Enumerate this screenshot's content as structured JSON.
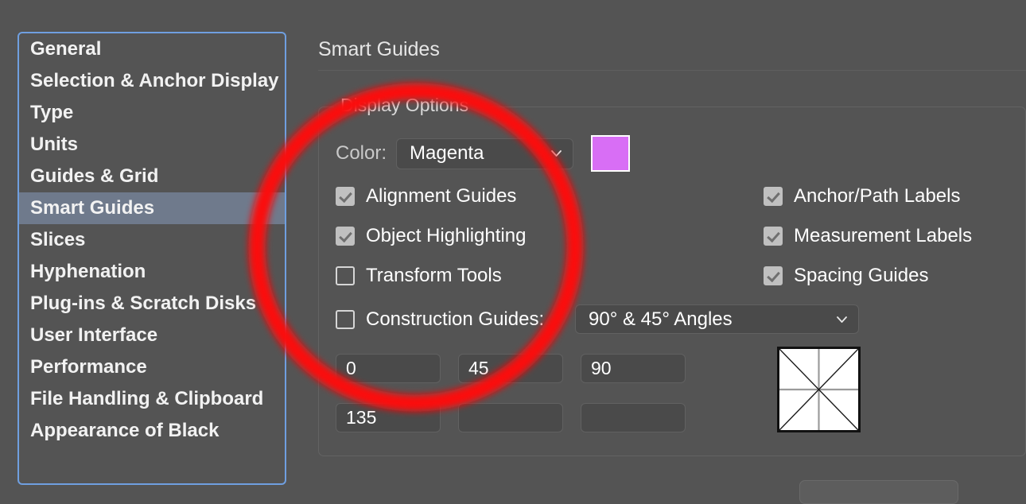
{
  "sidebar": {
    "selected": "Smart Guides",
    "items": [
      {
        "label": "General"
      },
      {
        "label": "Selection & Anchor Display"
      },
      {
        "label": "Type"
      },
      {
        "label": "Units"
      },
      {
        "label": "Guides & Grid"
      },
      {
        "label": "Smart Guides"
      },
      {
        "label": "Slices"
      },
      {
        "label": "Hyphenation"
      },
      {
        "label": "Plug-ins & Scratch Disks"
      },
      {
        "label": "User Interface"
      },
      {
        "label": "Performance"
      },
      {
        "label": "File Handling & Clipboard"
      },
      {
        "label": "Appearance of Black"
      }
    ]
  },
  "panel": {
    "title": "Smart Guides",
    "group_title": "Display Options",
    "color": {
      "label": "Color:",
      "value": "Magenta",
      "swatch_hex": "#d86ef5",
      "chevron_icon": "chevron-down-icon"
    },
    "checkboxes_left": [
      {
        "label": "Alignment Guides",
        "checked": true
      },
      {
        "label": "Object Highlighting",
        "checked": true
      },
      {
        "label": "Transform Tools",
        "checked": false
      }
    ],
    "checkboxes_right": [
      {
        "label": "Anchor/Path Labels",
        "checked": true
      },
      {
        "label": "Measurement Labels",
        "checked": true
      },
      {
        "label": "Spacing Guides",
        "checked": true
      }
    ],
    "construction": {
      "label": "Construction Guides:",
      "checked": false,
      "value": "90° & 45° Angles",
      "chevron_icon": "chevron-down-icon"
    },
    "angles": [
      "0",
      "45",
      "90",
      "135",
      "",
      ""
    ],
    "angle_preview_icon": "angle-preview-grid"
  },
  "annotation": {
    "color_hex": "#fb0c0c",
    "shape": "hand-drawn-ellipse"
  }
}
